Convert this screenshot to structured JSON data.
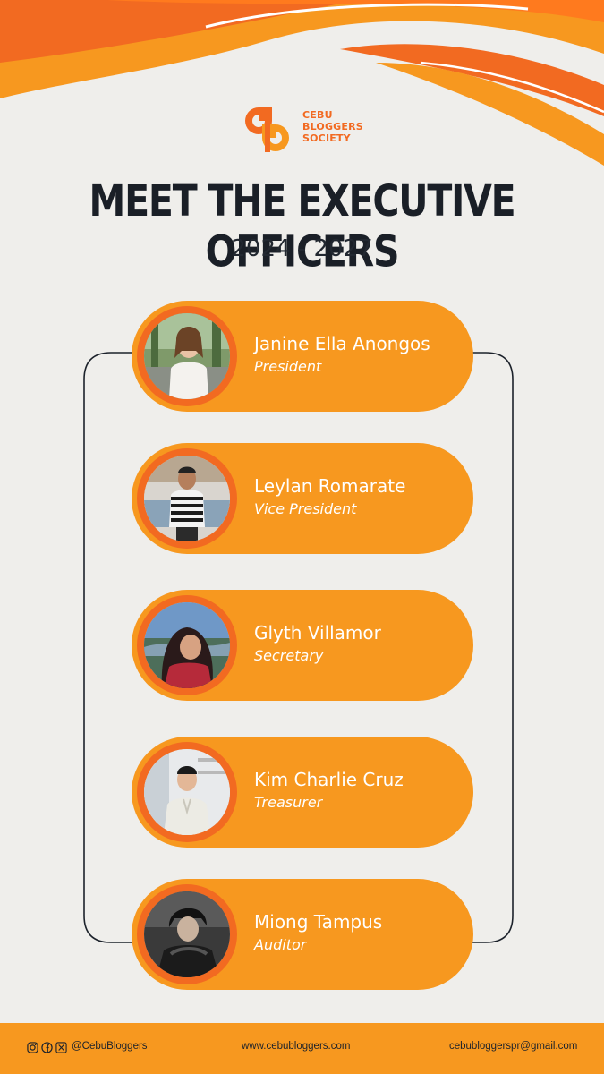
{
  "brand": {
    "logo_lines": [
      "CEBU",
      "BLOGGERS",
      "SOCIETY"
    ],
    "colors": {
      "primary_orange": "#f7981f",
      "deep_orange": "#f26a21",
      "background": "#efeeeb",
      "text_dark": "#1a1f27"
    }
  },
  "header": {
    "title": "MEET THE EXECUTIVE OFFICERS",
    "term": "2024 - 2027"
  },
  "officers": [
    {
      "name": "Janine Ella Anongos",
      "role": "President"
    },
    {
      "name": "Leylan Romarate",
      "role": "Vice President"
    },
    {
      "name": "Glyth Villamor",
      "role": "Secretary"
    },
    {
      "name": "Kim Charlie Cruz",
      "role": "Treasurer"
    },
    {
      "name": "Miong Tampus",
      "role": "Auditor"
    }
  ],
  "footer": {
    "social_icons": [
      "instagram-icon",
      "facebook-icon",
      "x-icon"
    ],
    "handle": "@CebuBloggers",
    "website": "www.cebubloggers.com",
    "email": "cebubloggerspr@gmail.com"
  }
}
